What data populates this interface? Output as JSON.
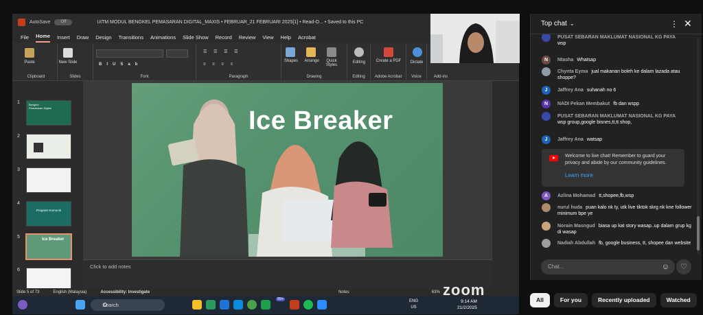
{
  "window": {
    "autosave_label": "AutoSave",
    "autosave_state": "Off",
    "title": "UiTM MODUL BENGKEL PEMASARAN DIGITAL_MAXIS • FEBRUAR_21 FEBRUARI 2025[1] • Read-O... • Saved to this PC"
  },
  "menu": [
    "File",
    "Home",
    "Insert",
    "Draw",
    "Design",
    "Transitions",
    "Animations",
    "Slide Show",
    "Record",
    "Review",
    "View",
    "Help",
    "Acrobat"
  ],
  "ribbon": {
    "groups": [
      "Clipboard",
      "Slides",
      "Font",
      "Paragraph",
      "Drawing",
      "Editing",
      "Adobe Acrobat",
      "Voice",
      "Add-ins"
    ],
    "buttons": {
      "paste": "Paste",
      "new_slide": "New Slide",
      "shapes": "Shapes",
      "arrange": "Arrange",
      "quick_styles": "Quick Styles",
      "editing": "Editing",
      "create_pdf": "Create a PDF",
      "dictate": "Dictate"
    }
  },
  "thumbnails": [
    {
      "num": "1",
      "title": "Bengkel Pemasaran Digital"
    },
    {
      "num": "2",
      "title": ""
    },
    {
      "num": "3",
      "title": ""
    },
    {
      "num": "4",
      "title": "Program Komuniti"
    },
    {
      "num": "5",
      "title": "Ice Breaker"
    },
    {
      "num": "6",
      "title": ""
    }
  ],
  "slide": {
    "title": "Ice Breaker"
  },
  "notes": {
    "placeholder": "Click to add notes"
  },
  "status": {
    "slide_of": "Slide 5 of 73",
    "language": "English (Malaysia)",
    "accessibility": "Accessibility: Investigate",
    "notes_btn": "Notes",
    "zoom": "63%"
  },
  "taskbar": {
    "search": "Search",
    "badge": "99+",
    "lang_1": "ENG",
    "lang_2": "US",
    "time": "9:14 AM",
    "date": "21/2/2025"
  },
  "zoom_brand": "zoom",
  "chat": {
    "title": "Top chat",
    "messages": [
      {
        "initial": "",
        "author": "PUSAT SEBARAN MAKLUMAT NASIONAL KG PAYA",
        "text": "wsp",
        "color": "#3949ab"
      },
      {
        "initial": "N",
        "author": "Ntasha",
        "text": "Whatsap",
        "color": "#6d4c41"
      },
      {
        "initial": "",
        "author": "Chynta Eyma",
        "text": "jual makanan boleh ke dalam lazada atau shoppe?",
        "color": "#8e9aa8"
      },
      {
        "initial": "J",
        "author": "Jaffrey Ana",
        "text": "suhanah no 6",
        "color": "#1e63b8"
      },
      {
        "initial": "N",
        "author": "NADI Pekan Membakut",
        "text": "fb dan wspp",
        "color": "#5e35b1"
      },
      {
        "initial": "",
        "author": "PUSAT SEBARAN MAKLUMAT NASIONAL KG PAYA",
        "text": "wsp group,google bisnes,tt,tt shop,",
        "color": "#3949ab"
      },
      {
        "initial": "J",
        "author": "Jaffrey Ana",
        "text": "watsap",
        "color": "#1e63b8"
      },
      {
        "initial": "A",
        "author": "Azlina Mohamad",
        "text": "tt,shopee,fb,wsp",
        "color": "#7e57c2"
      },
      {
        "initial": "",
        "author": "nurul huda",
        "text": "puan kalo nk ty, utk live tiktok skrg nk kne follower minimum bpe ye",
        "color": "#b08968"
      },
      {
        "initial": "",
        "author": "Norain Masngud",
        "text": "biasa up kat story wasap..up dalam grup kg di wasap",
        "color": "#c9a27e"
      },
      {
        "initial": "",
        "author": "Nadiah Abdullah",
        "text": "fb, google business, tt, shopee dan website",
        "color": "#9e9e9e"
      }
    ],
    "notice": {
      "text": "Welcome to live chat! Remember to guard your privacy and abide by our community guidelines.",
      "link": "Learn more"
    },
    "input_placeholder": "Chat..."
  },
  "filters": [
    "All",
    "For you",
    "Recently uploaded",
    "Watched"
  ]
}
